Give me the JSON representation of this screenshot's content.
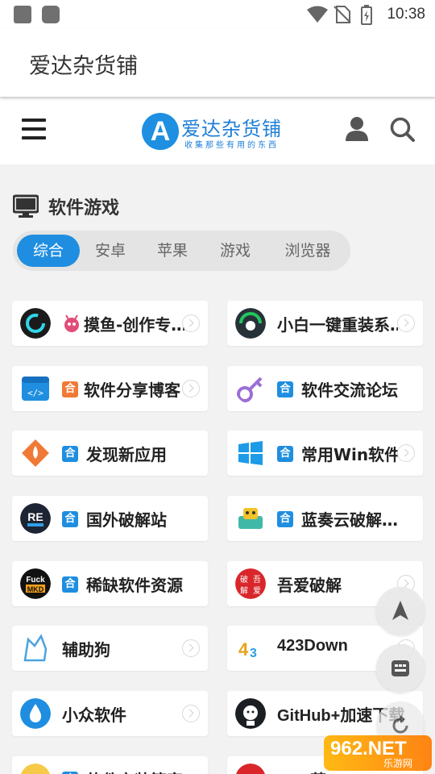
{
  "status_bar": {
    "time": "10:38"
  },
  "app_bar": {
    "title": "爱达杂货铺"
  },
  "header": {
    "logo_letter": "A",
    "logo_text": "爱达杂货铺",
    "logo_subtitle": "收集那些有用的东西"
  },
  "section": {
    "title": "软件游戏"
  },
  "tabs": [
    {
      "label": "综合",
      "active": true
    },
    {
      "label": "安卓",
      "active": false
    },
    {
      "label": "苹果",
      "active": false
    },
    {
      "label": "游戏",
      "active": false
    },
    {
      "label": "浏览器",
      "active": false
    }
  ],
  "badge_char": "合",
  "grid": [
    {
      "label": "摸鱼-创作专…",
      "icon": "moyu-icon",
      "badge": "monster",
      "badge_color": "#e24d7a"
    },
    {
      "label": "小白一键重装系…",
      "icon": "xiaobai-icon",
      "badge": null
    },
    {
      "label": "软件分享博客",
      "icon": "code-window-icon",
      "badge": "he",
      "badge_color": "#f07a35"
    },
    {
      "label": "软件交流论坛",
      "icon": "key-icon",
      "badge": "he",
      "badge_color": "#1f8ee0"
    },
    {
      "label": "发现新应用",
      "icon": "diamond-app-icon",
      "badge": "he",
      "badge_color": "#1f8ee0"
    },
    {
      "label": "常用Win软件",
      "icon": "windows-icon",
      "badge": "he",
      "badge_color": "#1f8ee0"
    },
    {
      "label": "国外破解站",
      "icon": "re-pack-icon",
      "badge": "he",
      "badge_color": "#1f8ee0"
    },
    {
      "label": "蓝奏云破解…",
      "icon": "lanzou-icon",
      "badge": "he",
      "badge_color": "#1f8ee0"
    },
    {
      "label": "稀缺软件资源",
      "icon": "fuck-mkd-icon",
      "badge": "he",
      "badge_color": "#1f8ee0"
    },
    {
      "label": "吾爱破解",
      "icon": "52pojie-icon",
      "badge": null
    },
    {
      "label": "辅助狗",
      "icon": "fuzhugou-icon",
      "badge": null
    },
    {
      "label": "423Down",
      "icon": "423down-icon",
      "badge": null
    },
    {
      "label": "小众软件",
      "icon": "waterdrop-icon",
      "badge": null
    },
    {
      "label": "GitHub+加速下载",
      "icon": "github-icon",
      "badge": null
    },
    {
      "label": "软件安装管家",
      "icon": "smile-icon",
      "badge": "he",
      "badge_color": "#1f8ee0"
    },
    {
      "label": "APP营",
      "icon": "app-icon",
      "badge": null
    }
  ],
  "fabs": [
    {
      "name": "scroll-top-button",
      "icon": "arrow-up-icon"
    },
    {
      "name": "calculator-button",
      "icon": "calculator-icon"
    },
    {
      "name": "refresh-button",
      "icon": "refresh-icon"
    }
  ],
  "watermark": {
    "text": "962.NET",
    "sub": "乐游网"
  },
  "colors": {
    "accent": "#1f8ee0",
    "background": "#f2f2f2"
  }
}
